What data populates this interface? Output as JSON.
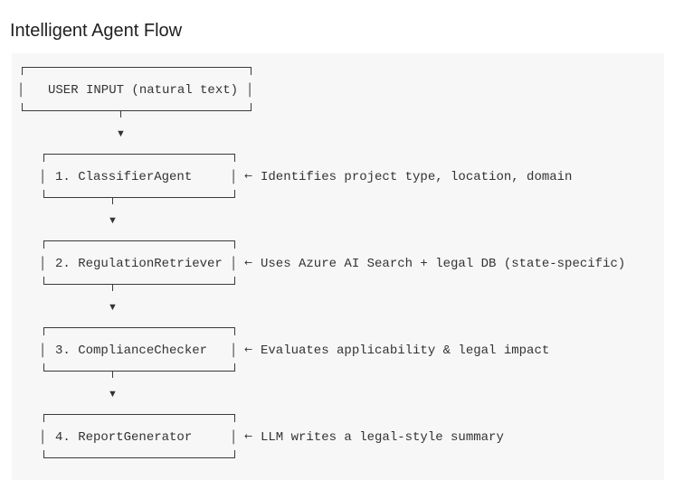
{
  "title": "Intelligent Agent Flow",
  "flow": {
    "input": {
      "label": "USER INPUT (natural text)"
    },
    "steps": [
      {
        "label": "1. ClassifierAgent",
        "note": "Identifies project type, location, domain"
      },
      {
        "label": "2. RegulationRetriever",
        "note": "Uses Azure AI Search + legal DB (state-specific)"
      },
      {
        "label": "3. ComplianceChecker",
        "note": "Evaluates applicability & legal impact"
      },
      {
        "label": "4. ReportGenerator",
        "note": "LLM writes a legal-style summary"
      }
    ],
    "down_arrow_glyph": "▼",
    "note_arrow_glyph": "←",
    "box_border_glyph": "│"
  }
}
